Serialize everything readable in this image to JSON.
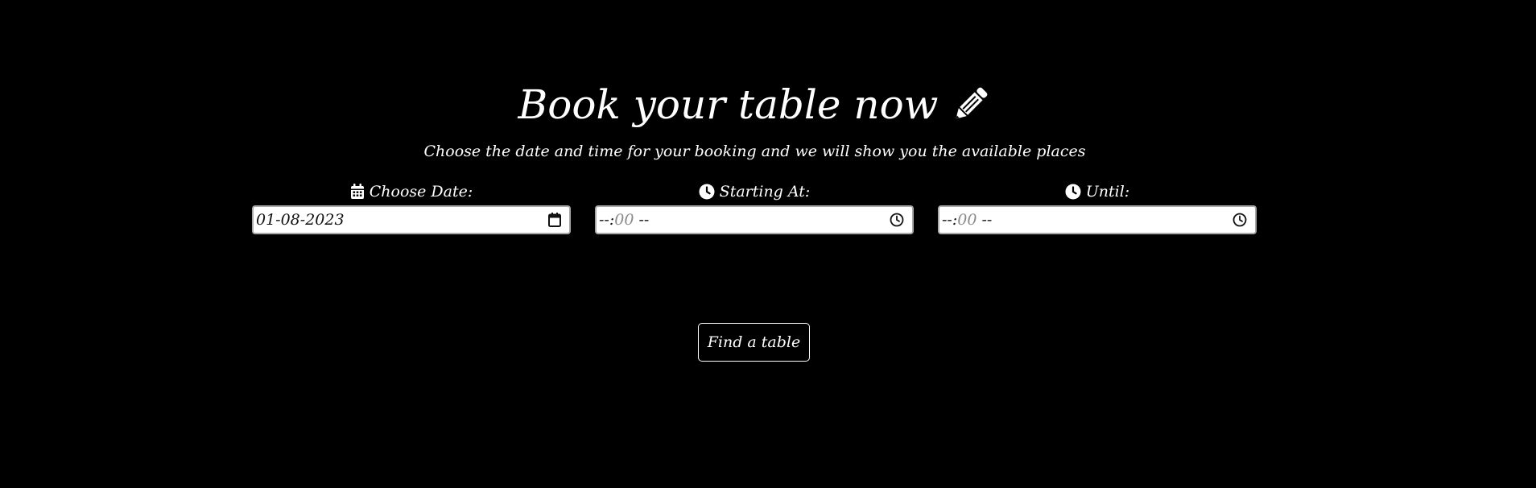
{
  "header": {
    "title": "Book your table now",
    "title_icon": "pencil-icon",
    "subtitle": "Choose the date and time for your booking and we will show you the available places"
  },
  "form": {
    "date": {
      "label": "Choose Date:",
      "icon": "calendar-icon",
      "value": "01-08-2023",
      "picker_icon": "calendar-picker-icon"
    },
    "start": {
      "label": "Starting At:",
      "icon": "clock-icon",
      "value_prefix": "--:",
      "value_minutes": "00",
      "value_suffix": "--",
      "picker_icon": "clock-picker-icon"
    },
    "until": {
      "label": "Until:",
      "icon": "clock-icon",
      "value_prefix": "--:",
      "value_minutes": "00",
      "value_suffix": "--",
      "picker_icon": "clock-picker-icon"
    },
    "submit_label": "Find a table"
  },
  "colors": {
    "background": "#000000",
    "text": "#ffffff",
    "input_bg": "#ffffff",
    "input_border": "#a9a9a9",
    "placeholder": "#8a8a8a"
  }
}
